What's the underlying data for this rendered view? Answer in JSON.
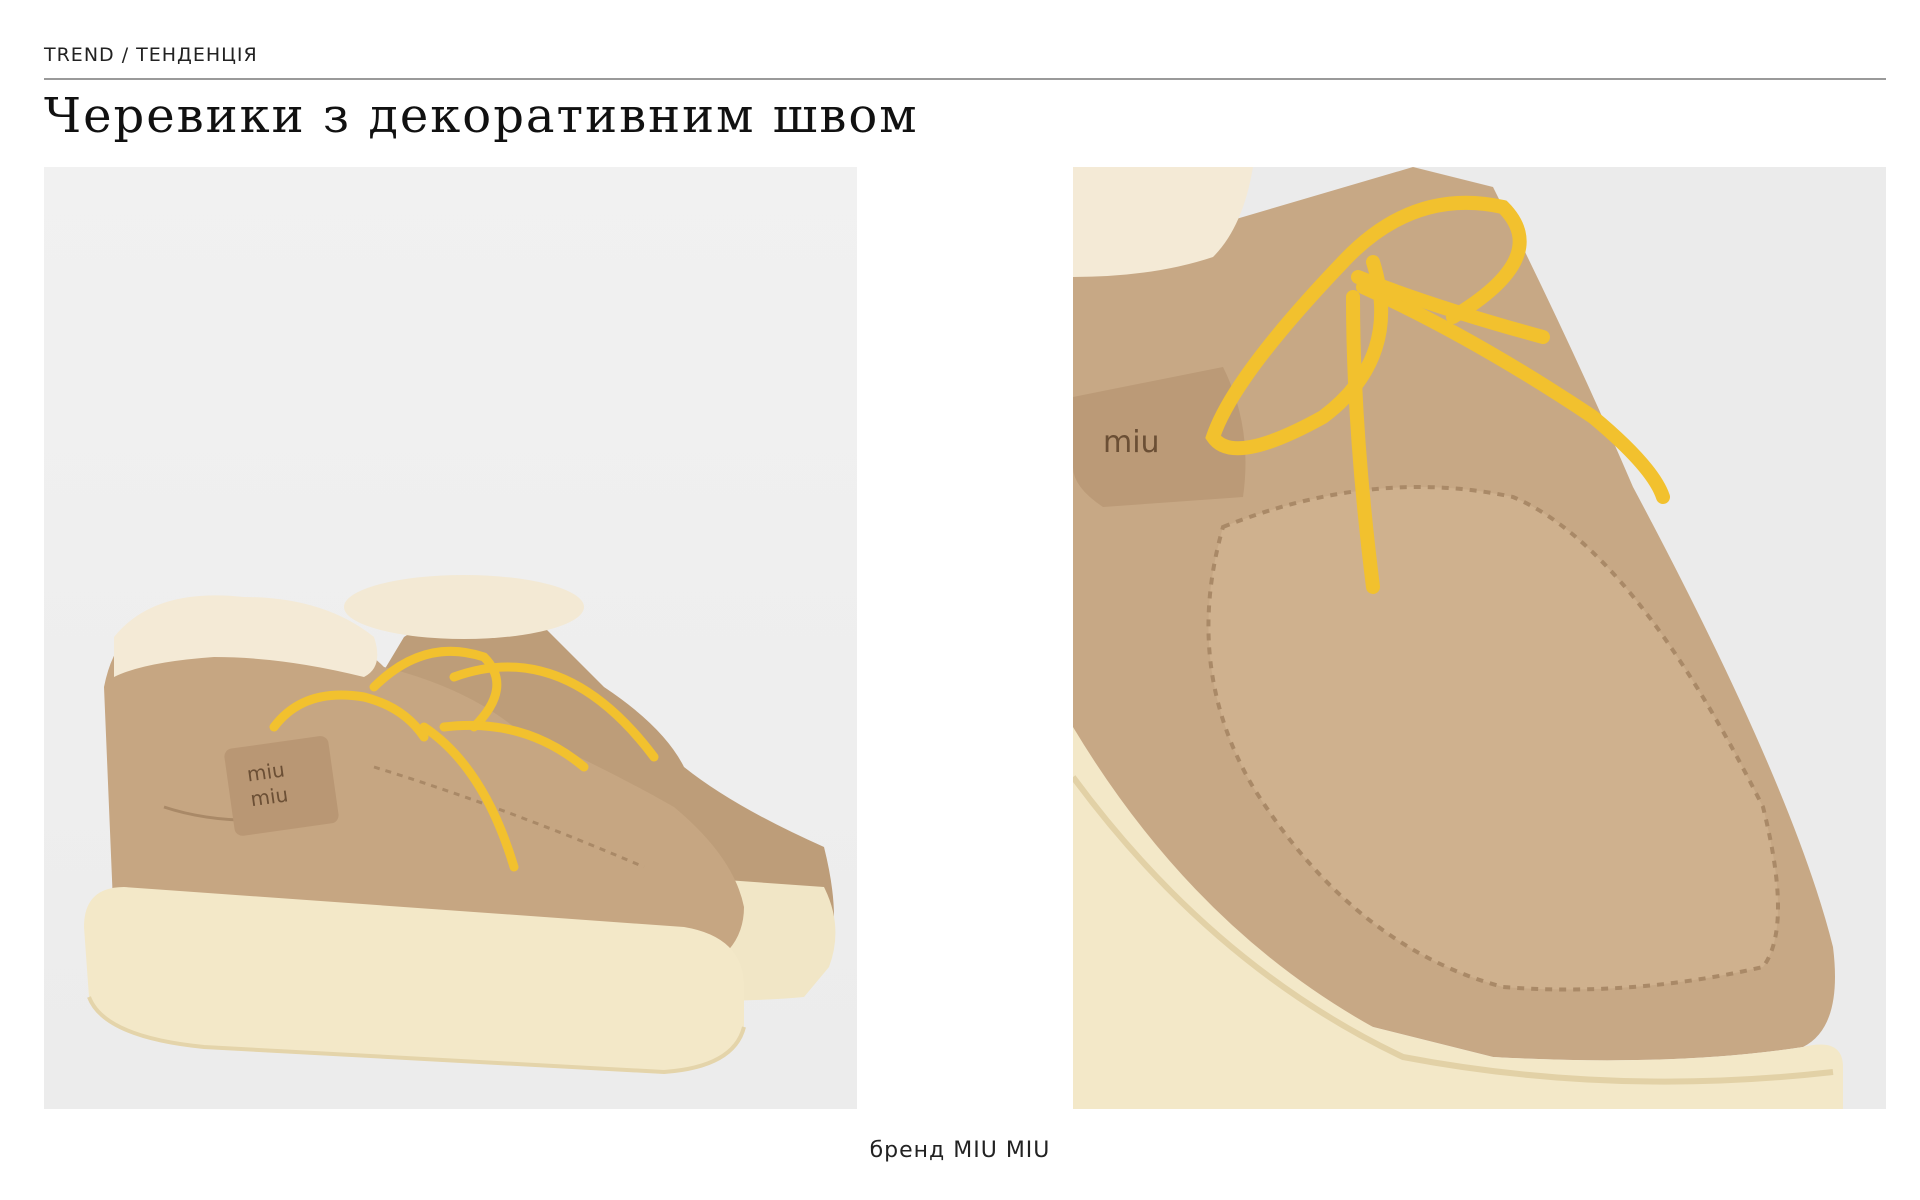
{
  "header": {
    "kicker": "TREND / ТЕНДЕНЦІЯ",
    "title": "Черевики з декоративним швом"
  },
  "images": {
    "left": {
      "subject": "pair of suede lace-up boots with shearling collar and yellow laces"
    },
    "right": {
      "subject": "close-up of suede boot toe with decorative stitching and yellow lace"
    }
  },
  "footer": {
    "caption": "бренд MIU MIU"
  },
  "colors": {
    "suede": "#c6a682",
    "suede_dark": "#a98967",
    "sole": "#f3e8c8",
    "shearling": "#f4ead6",
    "lace": "#f2c12e",
    "background": "#ffffff",
    "photo_bg": "#efefef",
    "rule": "#9a9a9a"
  }
}
